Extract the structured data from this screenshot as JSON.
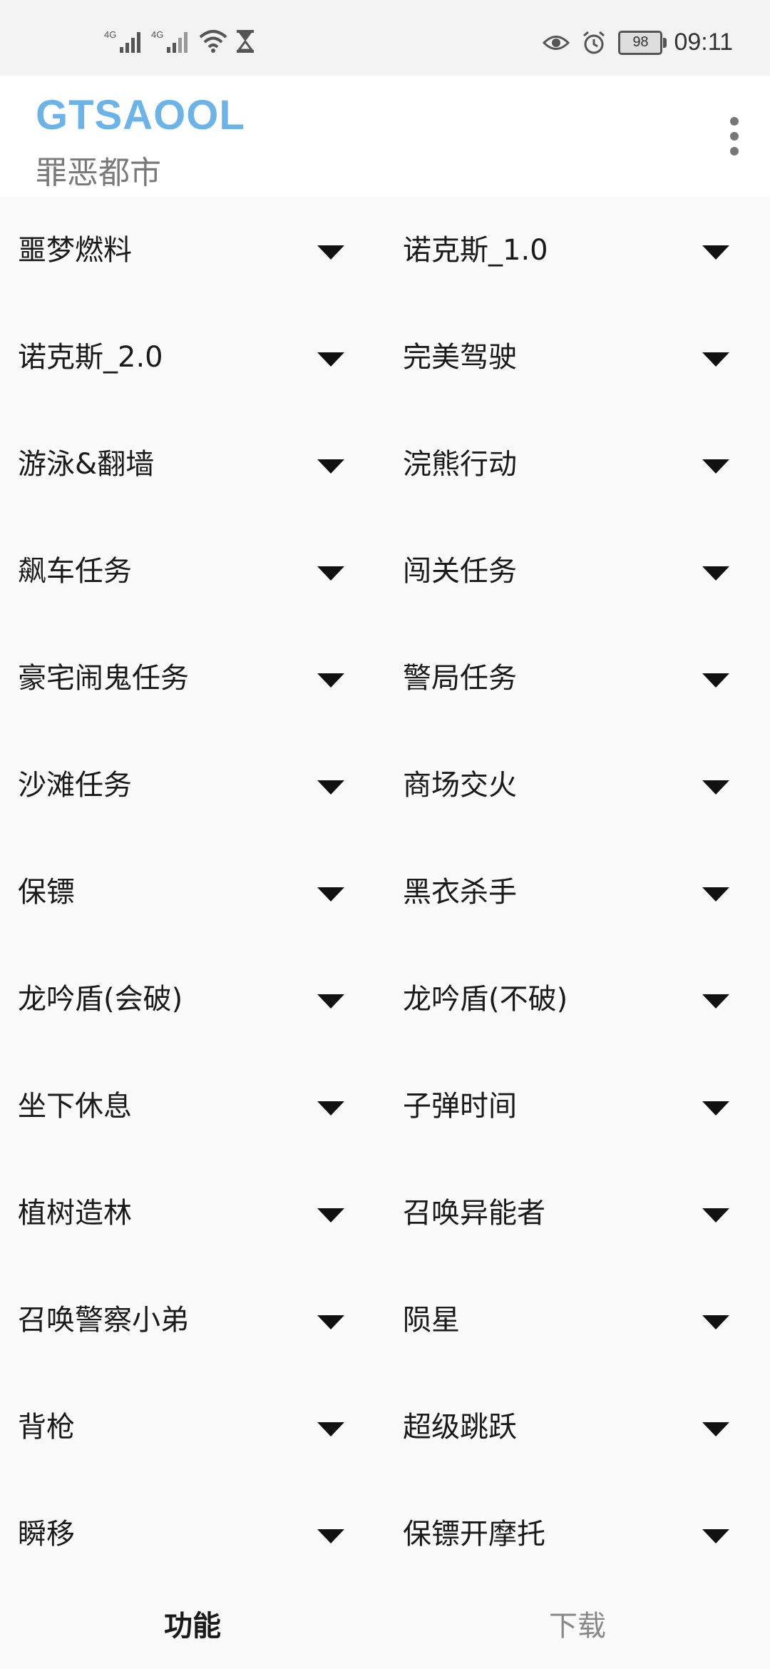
{
  "status_bar": {
    "sim1_label": "4G",
    "sim2_label": "4G",
    "battery_level": "98",
    "time": "09:11",
    "icons": [
      "signal-icon",
      "signal-icon",
      "wifi-icon",
      "hourglass-icon",
      "eye-icon",
      "alarm-icon",
      "battery-icon"
    ]
  },
  "header": {
    "title": "GTSAOOL",
    "subtitle": "罪恶都市",
    "title_color": "#6cb4e8"
  },
  "grid": {
    "rows": [
      {
        "left": "噩梦燃料",
        "right": "诺克斯_1.0"
      },
      {
        "left": "诺克斯_2.0",
        "right": "完美驾驶"
      },
      {
        "left": "游泳&翻墙",
        "right": "浣熊行动"
      },
      {
        "left": "飙车任务",
        "right": "闯关任务"
      },
      {
        "left": "豪宅闹鬼任务",
        "right": "警局任务"
      },
      {
        "left": "沙滩任务",
        "right": "商场交火"
      },
      {
        "left": "保镖",
        "right": "黑衣杀手"
      },
      {
        "left": "龙吟盾(会破)",
        "right": "龙吟盾(不破)"
      },
      {
        "left": "坐下休息",
        "right": "子弹时间"
      },
      {
        "left": "植树造林",
        "right": "召唤异能者"
      },
      {
        "left": "召唤警察小弟",
        "right": "陨星"
      },
      {
        "left": "背枪",
        "right": "超级跳跃"
      },
      {
        "left": "瞬移",
        "right": "保镖开摩托"
      }
    ]
  },
  "tabs": [
    {
      "label": "功能",
      "active": true
    },
    {
      "label": "下载",
      "active": false
    }
  ]
}
